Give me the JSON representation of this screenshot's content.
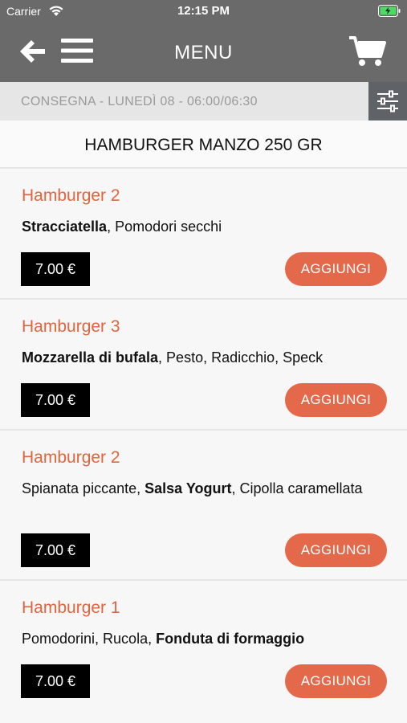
{
  "status_bar": {
    "carrier": "Carrier",
    "time": "12:15 PM"
  },
  "nav": {
    "title": "MENU",
    "icons": [
      "back-arrow-icon",
      "hamburger-menu-icon",
      "cart-icon"
    ]
  },
  "delivery": {
    "text": "CONSEGNA - LUNEDÌ 08 - 06:00/06:30",
    "filter_icon": "sliders-icon"
  },
  "section": {
    "title": "HAMBURGER MANZO 250 GR"
  },
  "colors": {
    "header": "#6a6a6a",
    "accent": "#e4694a",
    "name": "#e0643d"
  },
  "products": [
    {
      "name": "Hamburger 2",
      "desc": [
        {
          "t": "Stracciatella",
          "b": true
        },
        {
          "t": ", Pomodori secchi",
          "b": false
        }
      ],
      "price": "7.00 €",
      "add": "AGGIUNGI"
    },
    {
      "name": "Hamburger 3",
      "desc": [
        {
          "t": "Mozzarella di bufala",
          "b": true
        },
        {
          "t": ", Pesto, Radicchio, Speck",
          "b": false
        }
      ],
      "price": "7.00 €",
      "add": "AGGIUNGI"
    },
    {
      "name": "Hamburger 2",
      "desc": [
        {
          "t": "Spianata piccante, ",
          "b": false
        },
        {
          "t": "Salsa Yogurt",
          "b": true
        },
        {
          "t": ", Cipolla caramellata",
          "b": false
        }
      ],
      "price": "7.00 €",
      "add": "AGGIUNGI"
    },
    {
      "name": "Hamburger 1",
      "desc": [
        {
          "t": "Pomodorini, Rucola, ",
          "b": false
        },
        {
          "t": "Fonduta di formaggio",
          "b": true
        }
      ],
      "price": "7.00 €",
      "add": "AGGIUNGI"
    }
  ]
}
